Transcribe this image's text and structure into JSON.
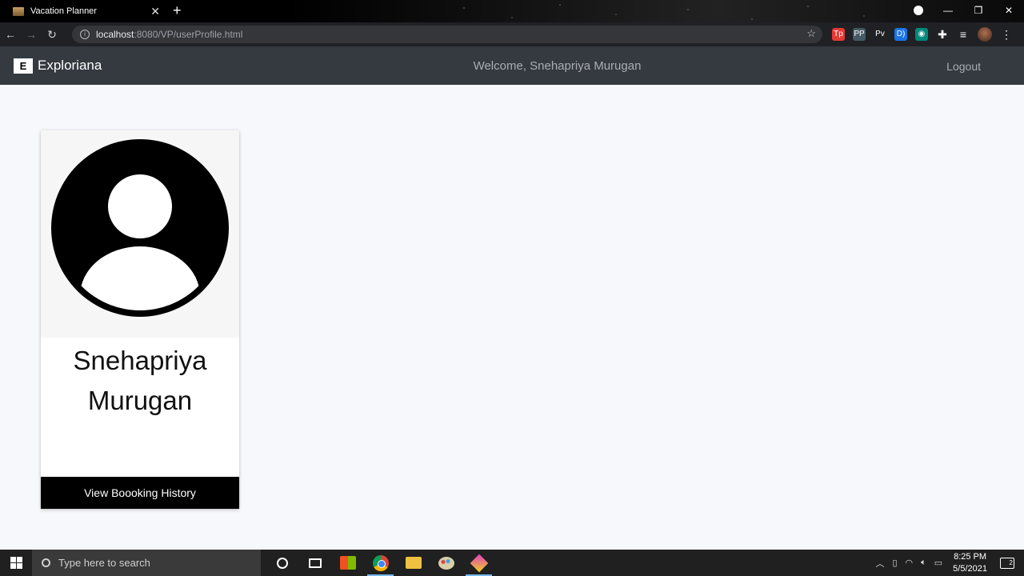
{
  "browser": {
    "tab_title": "Vacation Planner",
    "tab_close": "✕",
    "new_tab": "+",
    "url_host": "localhost",
    "url_path": ":8080/VP/userProfile.html",
    "window_controls": [
      "—",
      "❐",
      "✕"
    ],
    "extensions": [
      {
        "icon": "tp-extension-icon",
        "label": "Tp",
        "color": "#e53935"
      },
      {
        "icon": "pp-extension-icon",
        "label": "PP",
        "color": "#455a64"
      },
      {
        "icon": "pv-extension-icon",
        "label": "Pv",
        "color": "#202124"
      },
      {
        "icon": "translate-extension-icon",
        "label": "D)",
        "color": "#1a73e8"
      },
      {
        "icon": "circle-extension-icon",
        "label": "◉",
        "color": "#00897b"
      }
    ]
  },
  "app": {
    "brand_logo": "E",
    "brand_name": "Exploriana",
    "welcome": "Welcome, Snehapriya Murugan",
    "logout": "Logout"
  },
  "profile": {
    "name": "Snehapriya Murugan",
    "button_label": "View Boooking History"
  },
  "taskbar": {
    "search_placeholder": "Type here to search",
    "time": "8:25 PM",
    "date": "5/5/2021",
    "notification_count": "2"
  }
}
